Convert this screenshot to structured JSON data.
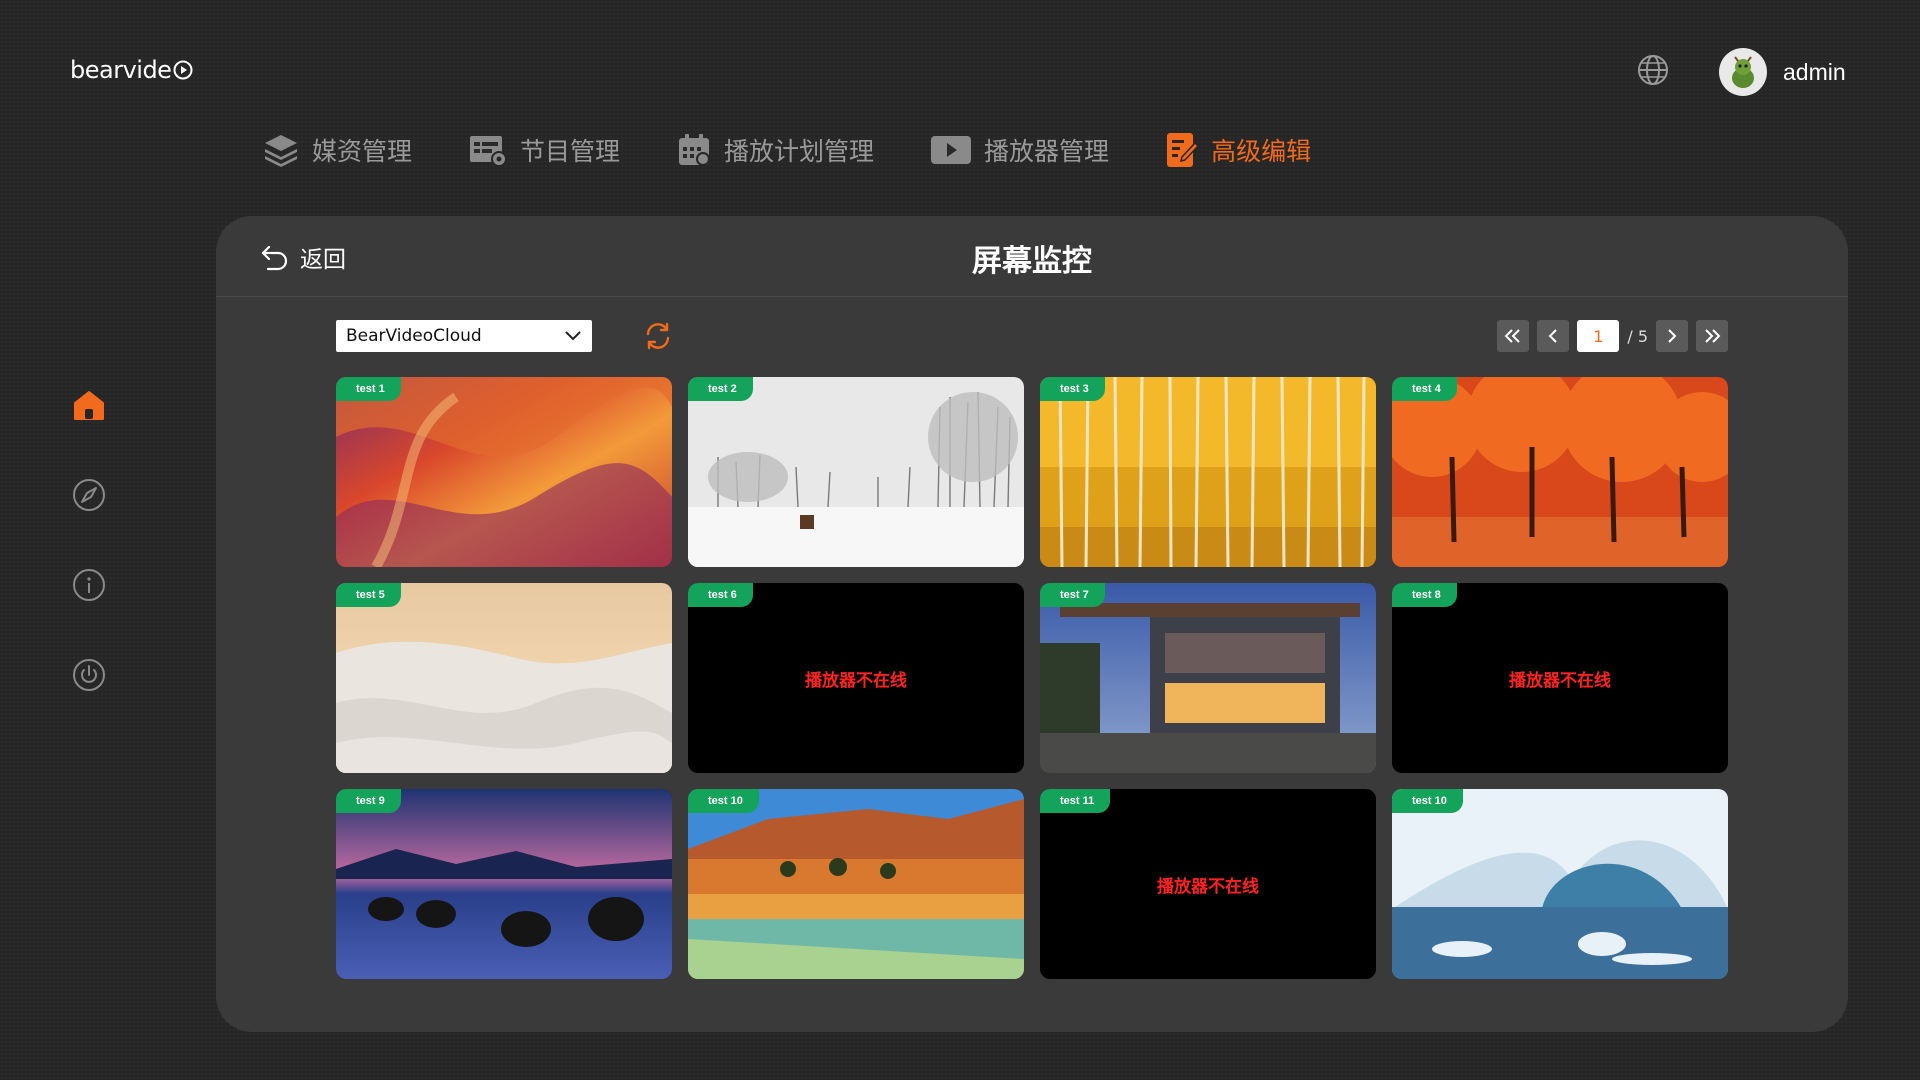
{
  "header": {
    "logo_text": "bearvide",
    "user_name": "admin",
    "globe_icon": "globe-icon"
  },
  "nav": {
    "items": [
      {
        "label": "媒资管理",
        "icon": "layers-icon",
        "active": false
      },
      {
        "label": "节目管理",
        "icon": "program-icon",
        "active": false
      },
      {
        "label": "播放计划管理",
        "icon": "calendar-icon",
        "active": false
      },
      {
        "label": "播放器管理",
        "icon": "player-icon",
        "active": false
      },
      {
        "label": "高级编辑",
        "icon": "edit-icon",
        "active": true
      }
    ]
  },
  "sidebar": {
    "icons": [
      "home-icon",
      "compass-icon",
      "info-icon",
      "power-icon"
    ]
  },
  "panel": {
    "back_label": "返回",
    "title": "屏幕监控"
  },
  "toolbar": {
    "selected_group": "BearVideoCloud",
    "pager": {
      "current": "1",
      "total": "/ 5"
    }
  },
  "tiles": [
    {
      "label": "test 1",
      "scene": "canyon",
      "offline": false
    },
    {
      "label": "test 2",
      "scene": "snow",
      "offline": false
    },
    {
      "label": "test 3",
      "scene": "yellow-forest",
      "offline": false
    },
    {
      "label": "test 4",
      "scene": "red-forest",
      "offline": false
    },
    {
      "label": "test 5",
      "scene": "desert-snow",
      "offline": false
    },
    {
      "label": "test 6",
      "offline": true,
      "offline_text": "播放器不在线"
    },
    {
      "label": "test 7",
      "scene": "house",
      "offline": false
    },
    {
      "label": "test 8",
      "offline": true,
      "offline_text": "播放器不在线"
    },
    {
      "label": "test 9",
      "scene": "lake-rocks",
      "offline": false
    },
    {
      "label": "test 10",
      "scene": "desert-lake",
      "offline": false
    },
    {
      "label": "test 11",
      "offline": true,
      "offline_text": "播放器不在线"
    },
    {
      "label": "test 10",
      "scene": "ice",
      "offline": false
    }
  ],
  "colors": {
    "accent": "#f26a1b",
    "tag_green": "#14a35a",
    "offline_red": "#ff2222",
    "panel_bg": "#3a3a3a",
    "page_bg": "#262626"
  }
}
